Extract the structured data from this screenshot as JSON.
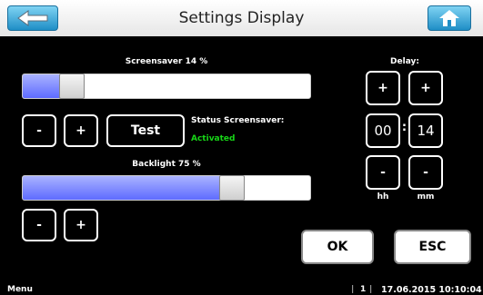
{
  "header": {
    "title": "Settings Display",
    "back_icon": "arrow-left-icon",
    "home_icon": "home-icon"
  },
  "screensaver": {
    "label": "Screensaver 14 %",
    "value_percent": 14,
    "buttons": {
      "minus": "-",
      "plus": "+",
      "test": "Test"
    },
    "status_label": "Status Screensaver:",
    "status_value": "Activated",
    "status_color": "#17d617"
  },
  "backlight": {
    "label": "Backlight 75 %",
    "value_percent": 75,
    "buttons": {
      "minus": "-",
      "plus": "+"
    }
  },
  "delay": {
    "label": "Delay:",
    "hh_plus": "+",
    "mm_plus": "+",
    "hours": "00",
    "separator": ":",
    "minutes": "14",
    "hh_minus": "-",
    "mm_minus": "-",
    "hh_label": "hh",
    "mm_label": "mm"
  },
  "actions": {
    "ok": "OK",
    "esc": "ESC"
  },
  "footer": {
    "menu": "Menu",
    "page_sep_left": "|",
    "page": "1",
    "page_sep_right": "|",
    "datetime": "17.06.2015 10:10:04"
  },
  "colors": {
    "header_button": "#1f8ec6",
    "slider_fill": "#5e6bff",
    "status_active": "#17d617"
  }
}
